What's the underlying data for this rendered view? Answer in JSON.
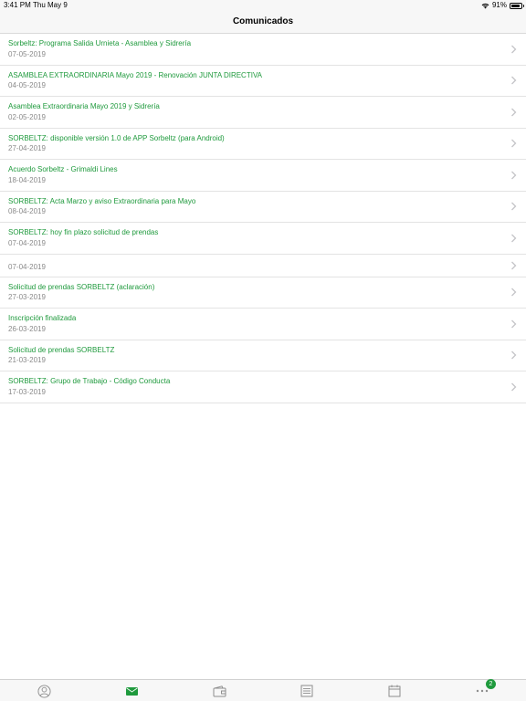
{
  "status_bar": {
    "time": "3:41 PM",
    "date": "Thu May 9",
    "battery": "91%"
  },
  "nav": {
    "title": "Comunicados"
  },
  "items": [
    {
      "title": "Sorbeltz: Programa Salida Urnieta - Asamblea y Sidrería",
      "date": "07-05-2019"
    },
    {
      "title": "ASAMBLEA EXTRAORDINARIA Mayo 2019 - Renovación JUNTA DIRECTIVA",
      "date": "04-05-2019"
    },
    {
      "title": "Asamblea Extraordinaria Mayo 2019 y Sidrería",
      "date": "02-05-2019"
    },
    {
      "title": "SORBELTZ: disponible versión 1.0 de APP Sorbeltz (para Android)",
      "date": "27-04-2019"
    },
    {
      "title": "Acuerdo Sorbeltz - Grimaldi Lines",
      "date": "18-04-2019"
    },
    {
      "title": "SORBELTZ: Acta Marzo y aviso Extraordinaria para Mayo",
      "date": "08-04-2019"
    },
    {
      "title": "SORBELTZ: hoy fin plazo solicitud de prendas",
      "date": "07-04-2019"
    },
    {
      "title": "",
      "date": "07-04-2019"
    },
    {
      "title": "Solicitud de prendas SORBELTZ (aclaración)",
      "date": "27-03-2019"
    },
    {
      "title": "Inscripción finalizada",
      "date": "26-03-2019"
    },
    {
      "title": "Solicitud de prendas SORBELTZ",
      "date": "21-03-2019"
    },
    {
      "title": "SORBELTZ: Grupo de Trabajo - Código Conducta",
      "date": "17-03-2019"
    }
  ],
  "tabs": [
    {
      "icon": "user-circle-icon",
      "active": false
    },
    {
      "icon": "envelope-icon",
      "active": true
    },
    {
      "icon": "wallet-icon",
      "active": false
    },
    {
      "icon": "list-icon",
      "active": false
    },
    {
      "icon": "calendar-icon",
      "active": false
    },
    {
      "icon": "more-icon",
      "active": false,
      "badge": "2"
    }
  ],
  "colors": {
    "accent": "#1f9a3d",
    "inactive": "#8e8e8e",
    "date": "#8a8a8a"
  }
}
